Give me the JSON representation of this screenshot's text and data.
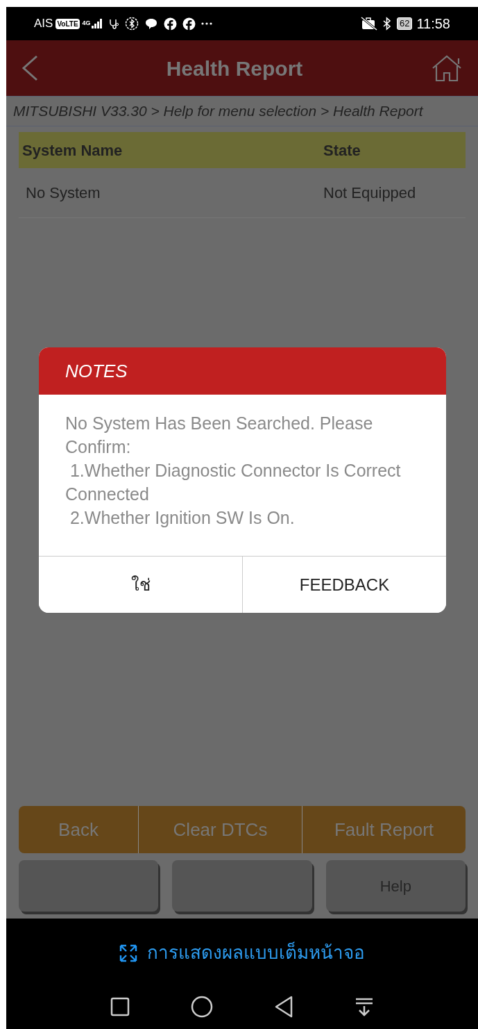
{
  "status_bar": {
    "carrier": "AIS",
    "volte": "VoLTE",
    "network": "4G",
    "battery": "62",
    "time": "11:58"
  },
  "header": {
    "title": "Health Report"
  },
  "breadcrumb": "MITSUBISHI V33.30 > Help for menu selection > Health Report",
  "table": {
    "columns": [
      "System Name",
      "State"
    ],
    "rows": [
      [
        "No System",
        "Not Equipped"
      ]
    ]
  },
  "dialog": {
    "title": "NOTES",
    "message": "No System Has Been Searched. Please Confirm:\n 1.Whether Diagnostic Connector Is Correct Connected\n 2.Whether Ignition SW Is On.",
    "buttons": [
      "ใช่",
      "FEEDBACK"
    ]
  },
  "action_buttons": [
    "Back",
    "Clear DTCs",
    "Fault Report"
  ],
  "secondary_buttons": [
    {
      "kind": "blank"
    },
    {
      "kind": "blank"
    },
    {
      "kind": "labeled",
      "label": "Help"
    }
  ],
  "fullscreen_hint": "การแสดงผลแบบเต็มหน้าจอ"
}
